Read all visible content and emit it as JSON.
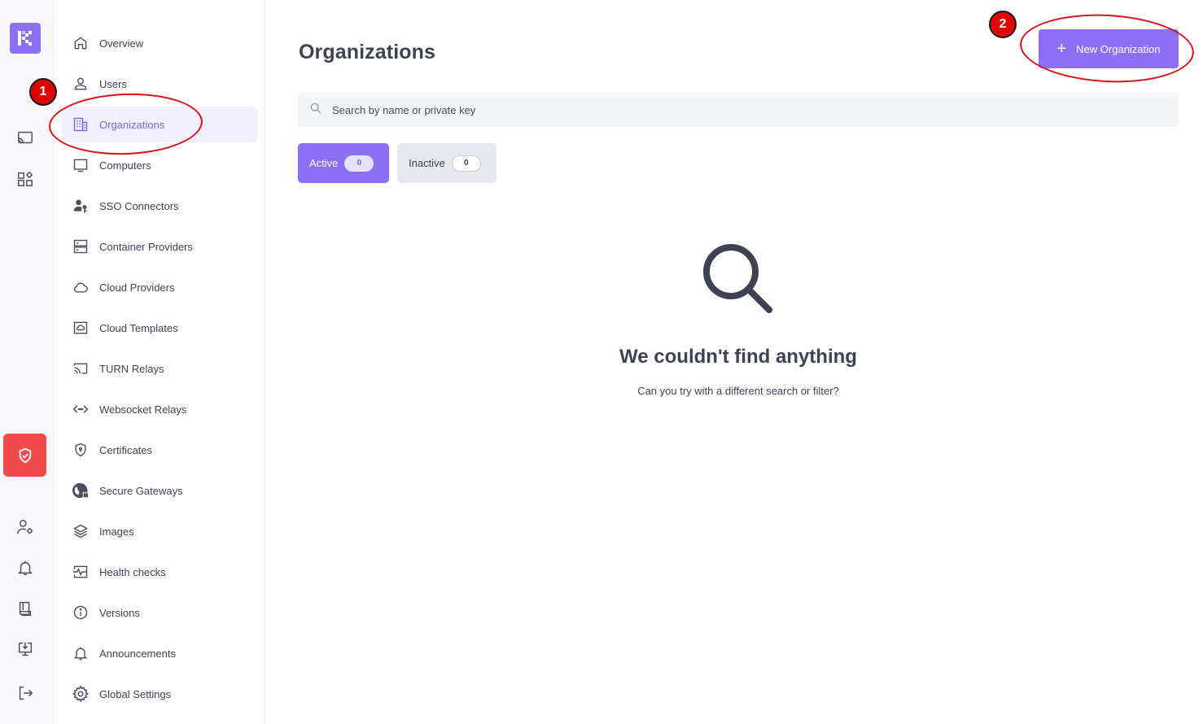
{
  "rail": {
    "logo_icon": "logo-icon",
    "icons": [
      "cast-icon",
      "widgets-icon",
      "shield-check-icon",
      "user-settings-icon",
      "bell-icon",
      "book-icon",
      "download-monitor-icon",
      "logout-icon"
    ],
    "alert_color": "#f04a4a"
  },
  "nav": {
    "items": [
      {
        "label": "Overview",
        "icon": "home-icon"
      },
      {
        "label": "Users",
        "icon": "user-icon"
      },
      {
        "label": "Organizations",
        "icon": "building-icon"
      },
      {
        "label": "Computers",
        "icon": "monitor-icon"
      },
      {
        "label": "SSO Connectors",
        "icon": "user-key-icon"
      },
      {
        "label": "Container Providers",
        "icon": "server-icon"
      },
      {
        "label": "Cloud Providers",
        "icon": "cloud-icon"
      },
      {
        "label": "Cloud Templates",
        "icon": "cloud-box-icon"
      },
      {
        "label": "TURN Relays",
        "icon": "cast-icon"
      },
      {
        "label": "Websocket Relays",
        "icon": "code-arrows-icon"
      },
      {
        "label": "Certificates",
        "icon": "shield-lock-icon"
      },
      {
        "label": "Secure Gateways",
        "icon": "globe-lock-icon"
      },
      {
        "label": "Images",
        "icon": "layers-icon"
      },
      {
        "label": "Health checks",
        "icon": "pulse-icon"
      },
      {
        "label": "Versions",
        "icon": "info-icon"
      },
      {
        "label": "Announcements",
        "icon": "bell-icon"
      },
      {
        "label": "Global Settings",
        "icon": "gear-icon"
      }
    ],
    "active": "Organizations"
  },
  "main": {
    "title": "Organizations",
    "new_button": "New Organization",
    "search_placeholder": "Search by name or private key",
    "tabs": [
      {
        "label": "Active",
        "count": "0"
      },
      {
        "label": "Inactive",
        "count": "0"
      }
    ],
    "empty_title": "We couldn't find anything",
    "empty_subtitle": "Can you try with a different search or filter?"
  },
  "annotations": {
    "marker_1": "1",
    "marker_2": "2"
  },
  "colors": {
    "accent": "#8b6ff5",
    "annotation_red": "#d8111a"
  }
}
